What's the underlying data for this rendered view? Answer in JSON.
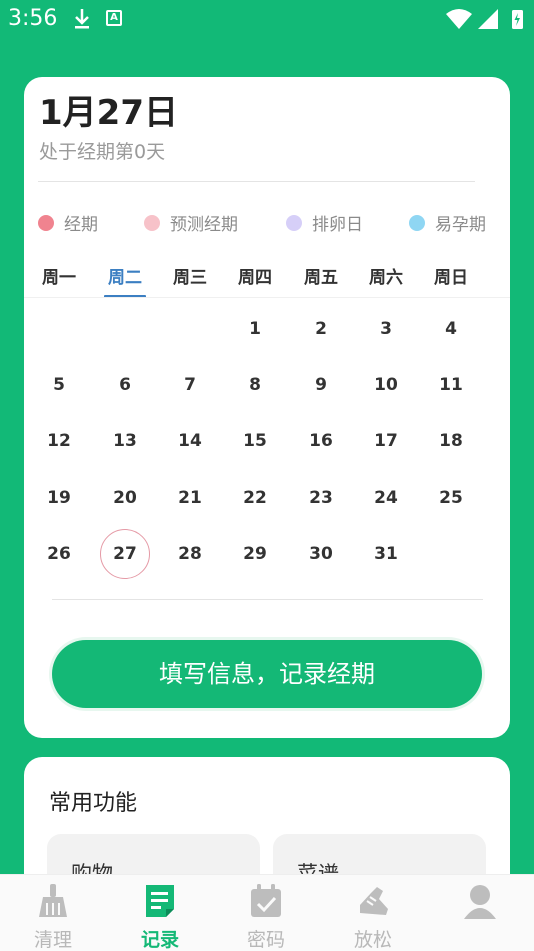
{
  "status_bar": {
    "time": "3:56"
  },
  "calendar": {
    "date_title": "1月27日",
    "period_status": "处于经期第0天",
    "legend": [
      {
        "label": "经期",
        "color": "#f0838f"
      },
      {
        "label": "预测经期",
        "color": "#f7c2c9"
      },
      {
        "label": "排卵日",
        "color": "#d6cff8"
      },
      {
        "label": "易孕期",
        "color": "#8fd6f3"
      }
    ],
    "weekdays": [
      "周一",
      "周二",
      "周三",
      "周四",
      "周五",
      "周六",
      "周日"
    ],
    "selected_weekday": "周二",
    "days": [
      "1",
      "2",
      "3",
      "4",
      "5",
      "6",
      "7",
      "8",
      "9",
      "10",
      "11",
      "12",
      "13",
      "14",
      "15",
      "16",
      "17",
      "18",
      "19",
      "20",
      "21",
      "22",
      "23",
      "24",
      "25",
      "26",
      "27",
      "28",
      "29",
      "30",
      "31"
    ],
    "today": "27",
    "record_button": "填写信息，记录经期"
  },
  "functions": {
    "title": "常用功能",
    "tiles": [
      "购物",
      "菜谱"
    ]
  },
  "bottom_nav": {
    "items": [
      {
        "label": "清理",
        "icon": "broom-icon"
      },
      {
        "label": "记录",
        "icon": "note-icon"
      },
      {
        "label": "密码",
        "icon": "calendar-check-icon"
      },
      {
        "label": "放松",
        "icon": "shoe-icon"
      },
      {
        "label": "",
        "icon": "profile-icon"
      }
    ],
    "active": "记录",
    "active_color": "#14b876"
  }
}
